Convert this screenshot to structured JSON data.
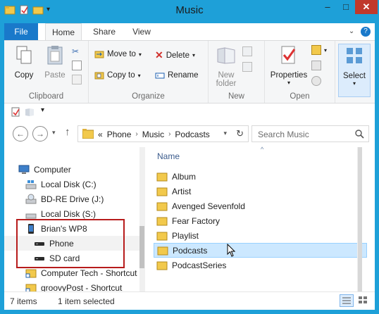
{
  "window": {
    "title": "Music",
    "min_symbol": "–",
    "max_symbol": "□",
    "close_symbol": "✕"
  },
  "ribbon_tabs": {
    "file": "File",
    "home": "Home",
    "share": "Share",
    "view": "View"
  },
  "ribbon": {
    "clipboard": {
      "copy": "Copy",
      "paste": "Paste",
      "label": "Clipboard"
    },
    "organize": {
      "move_to": "Move to",
      "copy_to": "Copy to",
      "delete": "Delete",
      "rename": "Rename",
      "label": "Organize"
    },
    "new": {
      "new_folder_line1": "New",
      "new_folder_line2": "folder",
      "label": "New"
    },
    "open": {
      "properties": "Properties",
      "label": "Open"
    },
    "select": {
      "select": "Select"
    }
  },
  "address": {
    "prefix": "«",
    "crumbs": [
      "Phone",
      "Music",
      "Podcasts"
    ],
    "separator": "›"
  },
  "search": {
    "placeholder": "Search Music"
  },
  "nav_tree": [
    {
      "label": "Computer",
      "icon": "computer-icon"
    },
    {
      "label": "Local Disk (C:)",
      "icon": "drive-icon"
    },
    {
      "label": "BD-RE Drive (J:)",
      "icon": "optical-drive-icon"
    },
    {
      "label": "Local Disk (S:)",
      "icon": "drive-icon"
    },
    {
      "label": "Brian's WP8",
      "icon": "phone-icon"
    },
    {
      "label": "Phone",
      "icon": "storage-icon"
    },
    {
      "label": "SD card",
      "icon": "storage-icon"
    },
    {
      "label": "Computer Tech - Shortcut",
      "icon": "shortcut-folder-icon"
    },
    {
      "label": "groovyPost - Shortcut",
      "icon": "shortcut-folder-icon"
    }
  ],
  "file_list": {
    "column_name": "Name",
    "items": [
      "Album",
      "Artist",
      "Avenged Sevenfold",
      "Fear Factory",
      "Playlist",
      "Podcasts",
      "PodcastSeries"
    ],
    "selected_item": "Podcasts"
  },
  "status": {
    "count": "7 items",
    "selection": "1 item selected"
  },
  "colors": {
    "accent": "#1ea0d8",
    "file_tab": "#1979ca",
    "selection": "#cce8ff",
    "highlight_box": "#b71c1c"
  }
}
